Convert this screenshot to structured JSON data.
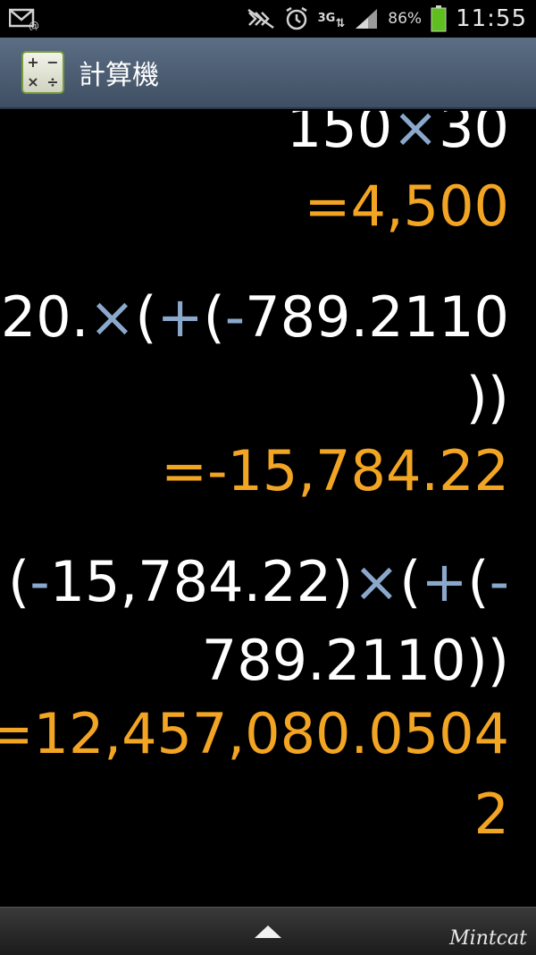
{
  "status_bar": {
    "network_type": "3G",
    "battery_percent": "86%",
    "time": "11:55",
    "icons": [
      "email-icon",
      "mute-icon",
      "alarm-icon",
      "signal-icon",
      "battery-icon"
    ]
  },
  "app_bar": {
    "title": "計算機",
    "icon_symbols": [
      "+",
      "−",
      "×",
      "÷"
    ]
  },
  "history": [
    {
      "expression": [
        "150",
        "×",
        "30"
      ],
      "result": "=4,500"
    },
    {
      "expression_lines": [
        [
          "20.",
          "×",
          "(",
          "+",
          "(",
          "-",
          "789.2110"
        ],
        [
          "))"
        ]
      ],
      "result": "=-15,784.22"
    },
    {
      "expression_lines": [
        [
          "(",
          "-",
          "15,784.22)",
          "×",
          "(",
          "+",
          "(",
          "-"
        ],
        [
          "789.2110))"
        ]
      ],
      "result_lines": [
        "=12,457,080.0504",
        "2"
      ]
    }
  ],
  "bottom_bar": {
    "expand_icon": "chevron-up-icon"
  },
  "watermark": "Mintcat",
  "colors": {
    "result": "#f2a423",
    "operator": "#8aa8cc",
    "expression": "#ffffff",
    "app_bar": "#4d5f75"
  }
}
